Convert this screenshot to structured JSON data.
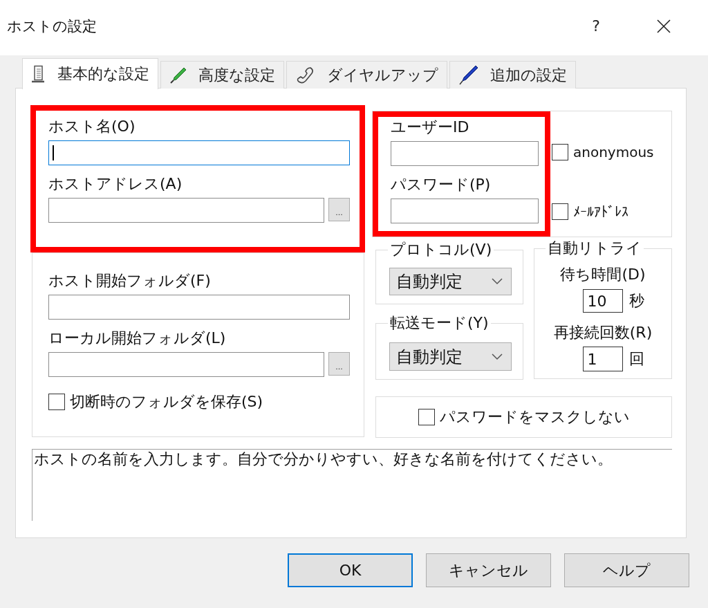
{
  "window": {
    "title": "ホストの設定",
    "help_button": "?"
  },
  "tabs": [
    {
      "label": "基本的な設定",
      "selected": true
    },
    {
      "label": "高度な設定",
      "selected": false
    },
    {
      "label": "ダイヤルアップ",
      "selected": false
    },
    {
      "label": "追加の設定",
      "selected": false
    }
  ],
  "host_section": {
    "highlighted": true,
    "fields": [
      {
        "label": "ホスト名(O)",
        "focused": true
      },
      {
        "label": "ホストアドレス(A)",
        "focused": false,
        "browse_button": "..."
      }
    ]
  },
  "folder_section": {
    "fields": [
      {
        "label": "ホスト開始フォルダ(F)"
      },
      {
        "label": "ローカル開始フォルダ(L)",
        "browse_button": "..."
      }
    ],
    "checkbox": {
      "label": "切断時のフォルダを保存(S)",
      "checked": false
    }
  },
  "account_section": {
    "highlighted": true,
    "fields": [
      {
        "label": "ユーザーID"
      },
      {
        "label": "パスワード(P)"
      }
    ],
    "checkboxes": [
      {
        "label": "anonymous",
        "checked": false
      },
      {
        "label": "ﾒｰﾙｱﾄﾞﾚｽ",
        "checked": false
      }
    ]
  },
  "protocol": {
    "legend": "プロトコル(V)",
    "value": "自動判定"
  },
  "transfer_mode": {
    "legend": "転送モード(Y)",
    "value": "自動判定"
  },
  "auto_retry": {
    "legend": "自動リトライ",
    "wait": {
      "label": "待ち時間(D)",
      "value": "10",
      "unit": "秒"
    },
    "reconnect": {
      "label": "再接続回数(R)",
      "value": "1",
      "unit": "回"
    }
  },
  "mask_password": {
    "label": "パスワードをマスクしない",
    "checked": false
  },
  "description": "ホストの名前を入力します。自分で分かりやすい、好きな名前を付けてください。",
  "buttons": [
    {
      "label": "OK",
      "default": true
    },
    {
      "label": "キャンセル",
      "default": false
    },
    {
      "label": "ヘルプ",
      "default": false
    }
  ]
}
